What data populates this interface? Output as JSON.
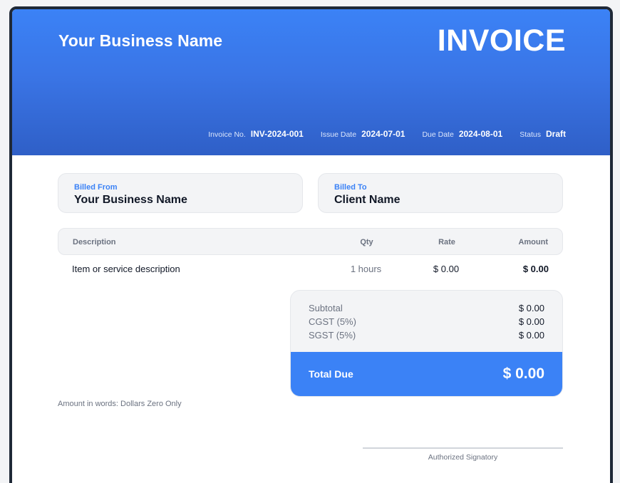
{
  "header": {
    "business_name": "Your Business Name",
    "title": "INVOICE",
    "meta": {
      "invoice_no_label": "Invoice No.",
      "invoice_no": "INV-2024-001",
      "issue_date_label": "Issue Date",
      "issue_date": "2024-07-01",
      "due_date_label": "Due Date",
      "due_date": "2024-08-01",
      "status_label": "Status",
      "status": "Draft"
    }
  },
  "billed_from": {
    "label": "Billed From",
    "name": "Your Business Name"
  },
  "billed_to": {
    "label": "Billed To",
    "name": "Client Name"
  },
  "table": {
    "columns": [
      "Description",
      "Qty",
      "Rate",
      "Amount"
    ],
    "rows": [
      {
        "description": "Item or service description",
        "qty": "1 hours",
        "rate": "$ 0.00",
        "amount": "$ 0.00"
      }
    ]
  },
  "totals": {
    "subtotal_label": "Subtotal",
    "subtotal": "$ 0.00",
    "cgst_label": "CGST (5%)",
    "cgst": "$ 0.00",
    "sgst_label": "SGST (5%)",
    "sgst": "$ 0.00",
    "total_due_label": "Total Due",
    "total_due": "$ 0.00"
  },
  "amount_in_words": "Amount in words: Dollars Zero Only",
  "signature_label": "Authorized Signatory",
  "colors": {
    "accent": "#3b82f6",
    "header_dark": "#2f5fc7",
    "panel": "#f3f4f6",
    "muted_text": "#6b7280"
  }
}
